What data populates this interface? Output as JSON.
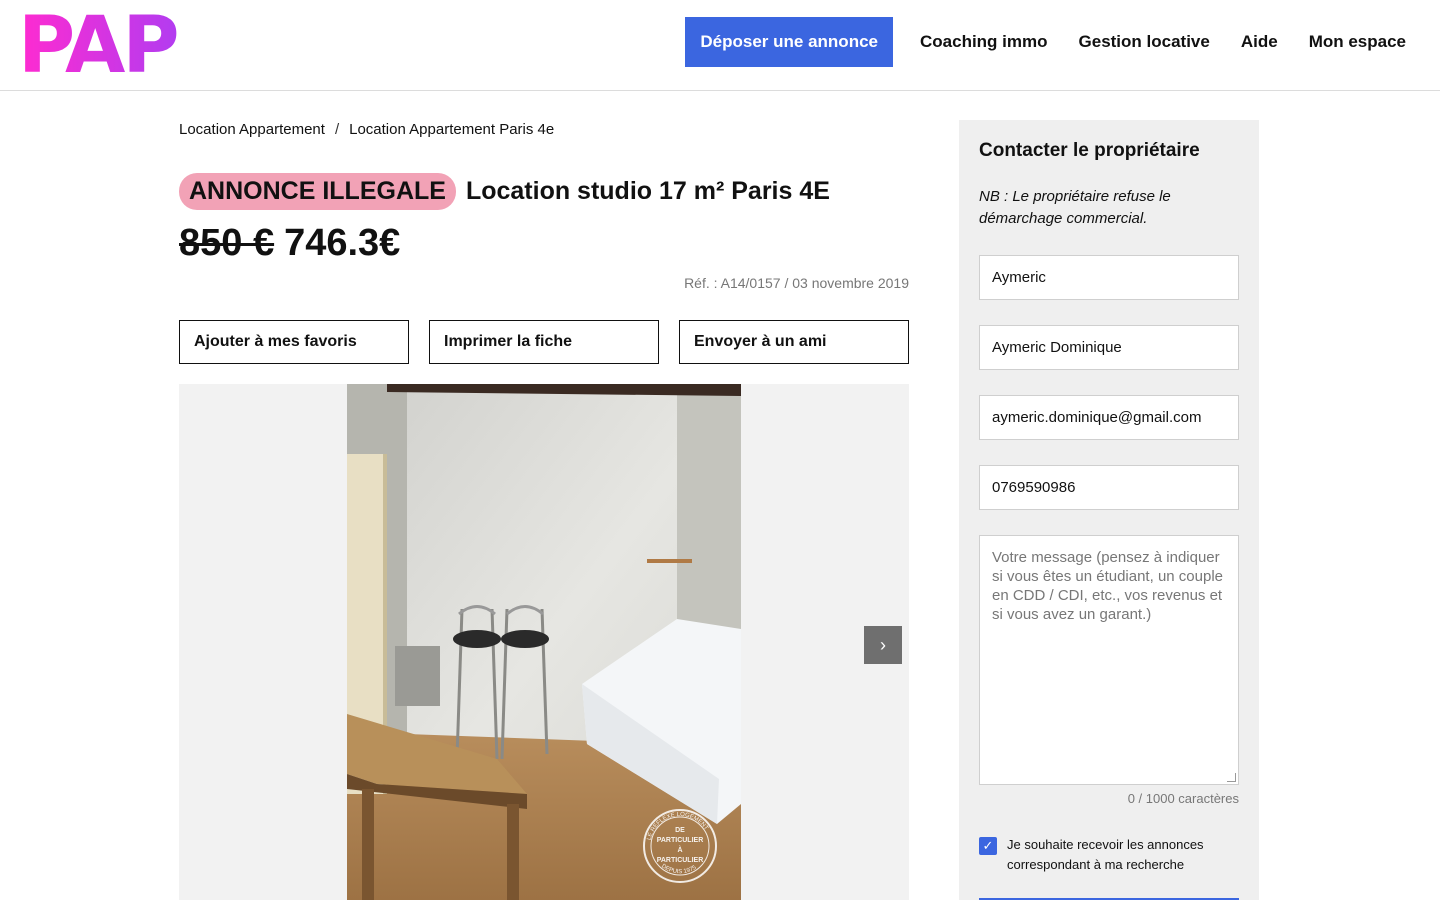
{
  "header": {
    "logo": "PAP",
    "cta_label": "Déposer une annonce",
    "nav": [
      "Coaching immo",
      "Gestion locative",
      "Aide",
      "Mon espace"
    ]
  },
  "breadcrumb": [
    "Location Appartement",
    "Location Appartement Paris 4e"
  ],
  "badge": "ANNONCE ILLEGALE",
  "title": "Location studio 17 m² Paris 4E",
  "price_old": "850 €",
  "price_new": "746.3€",
  "ref": "Réf. : A14/0157 / 03 novembre 2019",
  "actions": [
    "Ajouter à mes favoris",
    "Imprimer la fiche",
    "Envoyer à un ami"
  ],
  "gallery": {
    "next_icon": "chevron-right-icon",
    "watermark": {
      "top": "LE REFLEXE LOGEMENT",
      "center": [
        "DE",
        "PARTICULIER",
        "À",
        "PARTICULIER"
      ],
      "bottom": "DEPUIS 1975"
    }
  },
  "contact": {
    "title": "Contacter le propriétaire",
    "note": "NB : Le propriétaire refuse le démarchage commercial.",
    "first_name": "Aymeric",
    "full_name": "Aymeric Dominique",
    "email": "aymeric.dominique@gmail.com",
    "phone": "0769590986",
    "message_placeholder": "Votre message (pensez à indiquer si vous êtes un étudiant, un couple en CDD / CDI, etc., vos revenus et si vous avez un garant.)",
    "counter": "0 / 1000 caractères",
    "checkbox_checked": true,
    "checkbox_label": "Je souhaite recevoir les annonces correspondant à ma recherche"
  },
  "colors": {
    "logo_gradient": [
      "#ff2bd0",
      "#b33cf0"
    ],
    "cta": "#3b66e0",
    "badge": "#f2a2b6"
  }
}
